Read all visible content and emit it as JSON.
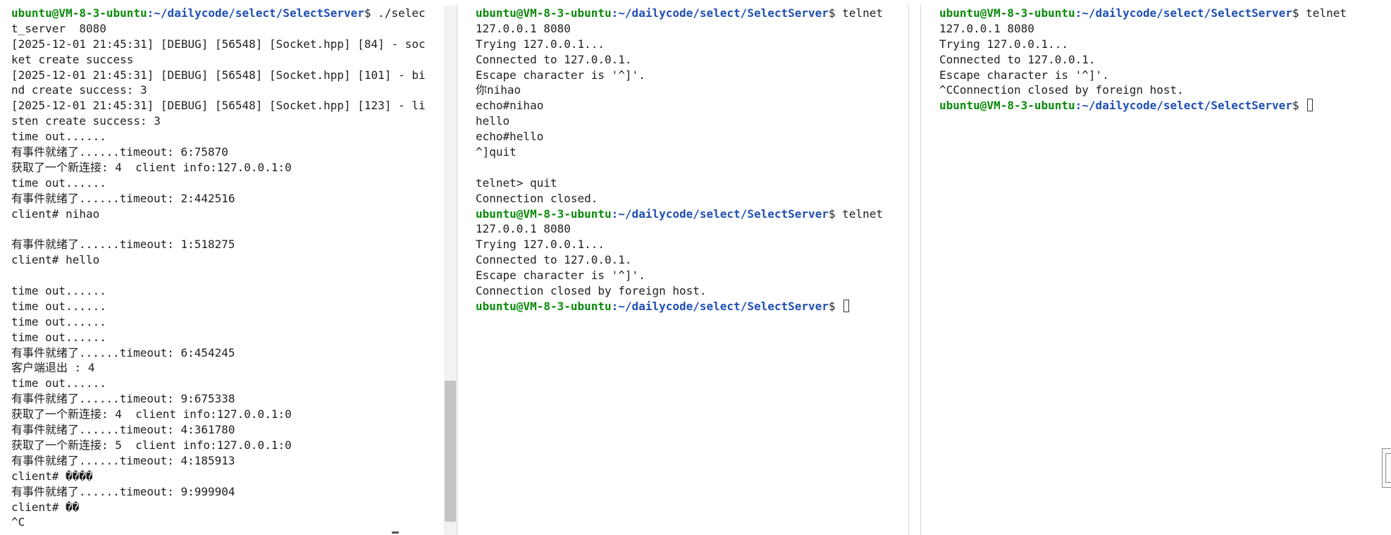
{
  "left": {
    "lines": [
      {
        "user": "ubuntu@VM-8-3-ubuntu",
        "path": ":~/dailycode/select/SelectServer",
        "rest": "$ ./selec"
      },
      {
        "text": "t_server  8080"
      },
      {
        "text": "[2025-12-01 21:45:31] [DEBUG] [56548] [Socket.hpp] [84] - soc"
      },
      {
        "text": "ket create success"
      },
      {
        "text": "[2025-12-01 21:45:31] [DEBUG] [56548] [Socket.hpp] [101] - bi"
      },
      {
        "text": "nd create success: 3"
      },
      {
        "text": "[2025-12-01 21:45:31] [DEBUG] [56548] [Socket.hpp] [123] - li"
      },
      {
        "text": "sten create success: 3"
      },
      {
        "text": "time out......"
      },
      {
        "text": "有事件就绪了......timeout: 6:75870"
      },
      {
        "text": "获取了一个新连接: 4  client info:127.0.0.1:0"
      },
      {
        "text": "time out......"
      },
      {
        "text": "有事件就绪了......timeout: 2:442516"
      },
      {
        "text": "client# nihao"
      },
      {
        "text": ""
      },
      {
        "text": "有事件就绪了......timeout: 1:518275"
      },
      {
        "text": "client# hello"
      },
      {
        "text": ""
      },
      {
        "text": "time out......"
      },
      {
        "text": "time out......"
      },
      {
        "text": "time out......"
      },
      {
        "text": "time out......"
      },
      {
        "text": "有事件就绪了......timeout: 6:454245"
      },
      {
        "text": "客户端退出 : 4"
      },
      {
        "text": "time out......"
      },
      {
        "text": "有事件就绪了......timeout: 9:675338"
      },
      {
        "text": "获取了一个新连接: 4  client info:127.0.0.1:0"
      },
      {
        "text": "有事件就绪了......timeout: 4:361780"
      },
      {
        "text": "获取了一个新连接: 5  client info:127.0.0.1:0"
      },
      {
        "text": "有事件就绪了......timeout: 4:185913"
      },
      {
        "text": "client# ����"
      },
      {
        "text": "有事件就绪了......timeout: 9:999904"
      },
      {
        "text": "client# ��"
      },
      {
        "text": "^C"
      }
    ]
  },
  "middle": {
    "lines": [
      {
        "user": "ubuntu@VM-8-3-ubuntu",
        "path": ":~/dailycode/select/SelectServer",
        "rest": "$ telnet"
      },
      {
        "text": "127.0.0.1 8080"
      },
      {
        "text": "Trying 127.0.0.1..."
      },
      {
        "text": "Connected to 127.0.0.1."
      },
      {
        "text": "Escape character is '^]'."
      },
      {
        "text": "你nihao"
      },
      {
        "text": "echo#nihao"
      },
      {
        "text": "hello"
      },
      {
        "text": "echo#hello"
      },
      {
        "text": "^]quit"
      },
      {
        "text": ""
      },
      {
        "text": "telnet> quit"
      },
      {
        "text": "Connection closed."
      },
      {
        "user": "ubuntu@VM-8-3-ubuntu",
        "path": ":~/dailycode/select/SelectServer",
        "rest": "$ telnet"
      },
      {
        "text": "127.0.0.1 8080"
      },
      {
        "text": "Trying 127.0.0.1..."
      },
      {
        "text": "Connected to 127.0.0.1."
      },
      {
        "text": "Escape character is '^]'."
      },
      {
        "text": "Connection closed by foreign host."
      },
      {
        "user": "ubuntu@VM-8-3-ubuntu",
        "path": ":~/dailycode/select/SelectServer",
        "rest": "$ ",
        "cursor": true
      }
    ]
  },
  "right": {
    "lines": [
      {
        "user": "ubuntu@VM-8-3-ubuntu",
        "path": ":~/dailycode/select/SelectServer",
        "rest": "$ telnet"
      },
      {
        "text": "127.0.0.1 8080"
      },
      {
        "text": "Trying 127.0.0.1..."
      },
      {
        "text": "Connected to 127.0.0.1."
      },
      {
        "text": "Escape character is '^]'."
      },
      {
        "text": "^CConnection closed by foreign host."
      },
      {
        "user": "ubuntu@VM-8-3-ubuntu",
        "path": ":~/dailycode/select/SelectServer",
        "rest": "$ ",
        "cursor": true
      }
    ]
  },
  "colors": {
    "prompt_user": "#0a8a0a",
    "prompt_path": "#1f4fb5",
    "text": "#1f1f1f",
    "background": "#ffffff"
  }
}
